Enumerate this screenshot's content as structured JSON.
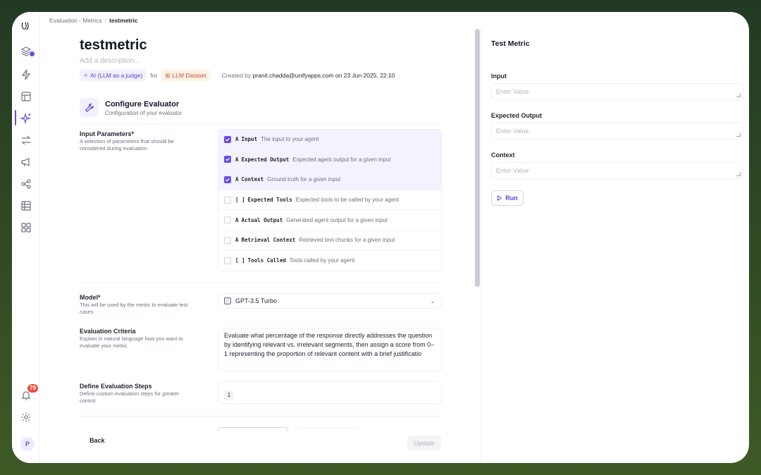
{
  "breadcrumb": {
    "parent": "Evaluation - Metrics",
    "separator": "/",
    "current": "testmetric"
  },
  "metric": {
    "title": "testmetric",
    "description_placeholder": "Add a description...",
    "type_tag": "AI (LLM as a judge)",
    "for_text": "for",
    "dataset_tag": "LLM Dataset",
    "created_prefix": "Created by",
    "created_by": "pranit.chadda@unifyapps.com",
    "created_on": "on 23 Jun 2025, 22:10"
  },
  "configure": {
    "title": "Configure Evaluator",
    "subtitle": "Configuration of your evaluator"
  },
  "input_parameters": {
    "label": "Input Parameters*",
    "description": "A selection of parameters that should be considered during evaluation",
    "items": [
      {
        "type": "A",
        "name": "Input",
        "desc": "The input to your agent",
        "checked": true
      },
      {
        "type": "A",
        "name": "Expected Output",
        "desc": "Expected agent output for a given input",
        "checked": true
      },
      {
        "type": "A",
        "name": "Context",
        "desc": "Ground truth for a given input",
        "checked": true
      },
      {
        "type": "[ ]",
        "name": "Expected Tools",
        "desc": "Expected tools to be called by your agent",
        "checked": false
      },
      {
        "type": "A",
        "name": "Actual Output",
        "desc": "Generated agent output for a given input",
        "checked": false
      },
      {
        "type": "A",
        "name": "Retrieval Context",
        "desc": "Retrieved text chunks for a given input",
        "checked": false
      },
      {
        "type": "[ ]",
        "name": "Tools Called",
        "desc": "Tools called by your agent",
        "checked": false
      }
    ]
  },
  "model": {
    "label": "Model*",
    "description": "This will be used by the metric to evaluate test cases",
    "value": "GPT-3.5 Turbo"
  },
  "criteria": {
    "label": "Evaluation Criteria",
    "description": "Explain in natural language how you want to evaluate your metric.",
    "value": "Evaluate what percentage of the response directly addresses the question by identifying relevant vs. irrelevant segments, then assign a score from 0–1 representing the proportion of relevant content with a brief justificatio"
  },
  "steps": {
    "label": "Define Evaluation Steps",
    "description": "Define custom evaluation steps for greater control",
    "first_step": "1"
  },
  "footer": {
    "back": "Back",
    "update": "Update"
  },
  "test_panel": {
    "title": "Test Metric",
    "fields": [
      {
        "label": "Input",
        "placeholder": "Enter Value"
      },
      {
        "label": "Expected Output",
        "placeholder": "Enter Value"
      },
      {
        "label": "Context",
        "placeholder": "Enter Value"
      }
    ],
    "run": "Run"
  },
  "rail": {
    "notification_count": "79",
    "avatar_initial": "P"
  },
  "colors": {
    "accent": "#6b4ee6",
    "badge": "#e5533d",
    "dataset": "#c2562a"
  }
}
